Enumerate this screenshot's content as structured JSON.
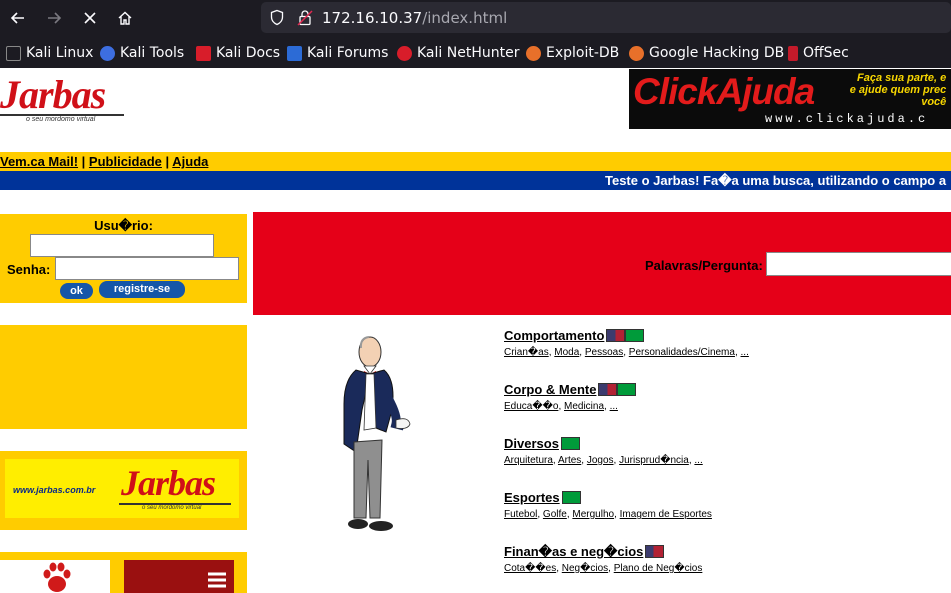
{
  "browser": {
    "url_host": "172.16.10.37",
    "url_path": "/index.html",
    "bookmarks": [
      "Kali Linux",
      "Kali Tools",
      "Kali Docs",
      "Kali Forums",
      "Kali NetHunter",
      "Exploit-DB",
      "Google Hacking DB",
      "OffSec"
    ]
  },
  "header": {
    "logo_text": "Jarbas",
    "logo_tagline": "o seu mordomo virtual",
    "ad_logo": "ClickAjuda",
    "ad_url": "www.clickajuda.c",
    "ad_side_text_1": "Faça sua parte, e",
    "ad_side_text_2": "e ajude quem prec",
    "ad_side_text_3": "você"
  },
  "topnav": {
    "mail": "Vem.ca Mail!",
    "sep1": " | ",
    "ads": "Publicidade",
    "sep2": " | ",
    "help": "Ajuda"
  },
  "ticker": "Teste o Jarbas! Fa�a uma busca, utilizando o campo a",
  "login": {
    "user_label": "Usu�rio:",
    "pass_label": "Senha:",
    "ok": "ok",
    "register": "registre-se"
  },
  "banner": {
    "url": "www.jarbas.com.br",
    "logo": "Jarbas",
    "tagline": "o seu mordomo virtual"
  },
  "search": {
    "label": "Palavras/Pergunta:"
  },
  "categories": [
    {
      "title": "Comportamento",
      "links": [
        "Crian�as",
        "Moda",
        "Pessoas",
        "Personalidades/Cinema",
        "..."
      ]
    },
    {
      "title": "Corpo & Mente",
      "links": [
        "Educa��o",
        "Medicina",
        "..."
      ]
    },
    {
      "title": "Diversos",
      "links": [
        "Arquitetura",
        "Artes",
        "Jogos",
        "Jurisprud�ncia",
        "..."
      ]
    },
    {
      "title": "Esportes",
      "links": [
        "Futebol",
        "Golfe",
        "Mergulho",
        "Imagem de Esportes"
      ]
    },
    {
      "title": "Finan�as e neg�cios",
      "links": [
        "Cota��es",
        "Neg�cios",
        "Plano de Neg�cios"
      ]
    }
  ]
}
